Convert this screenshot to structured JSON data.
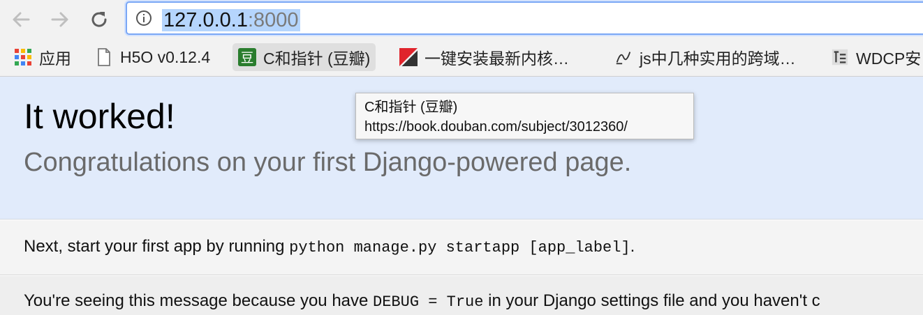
{
  "toolbar": {
    "url_host": "127.0.0.1",
    "url_port": ":8000"
  },
  "bookmarks": [
    {
      "label": "应用",
      "icon": "apps-grid-icon"
    },
    {
      "label": "H5O v0.12.4",
      "icon": "page-icon"
    },
    {
      "label": "C和指针 (豆瓣)",
      "icon": "douban-icon"
    },
    {
      "label": "一键安装最新内核…",
      "icon": "red-gray-icon"
    },
    {
      "label": "js中几种实用的跨域…",
      "icon": "script-icon"
    },
    {
      "label": "WDCP安",
      "icon": "wdcp-icon"
    }
  ],
  "tooltip": {
    "title": "C和指针 (豆瓣)",
    "url": "https://book.douban.com/subject/3012360/"
  },
  "page": {
    "title": "It worked!",
    "subtitle": "Congratulations on your first Django-powered page.",
    "next_prefix": "Next, start your first app by running ",
    "next_code": "python manage.py startapp [app_label]",
    "next_suffix": ".",
    "explain_prefix": "You're seeing this message because you have ",
    "explain_code": "DEBUG = True",
    "explain_suffix": " in your Django settings file and you haven't c"
  },
  "colors": {
    "hero_bg": "#e1ebfb",
    "url_border": "#7aa7f5",
    "douban_green": "#2a7d2e"
  }
}
